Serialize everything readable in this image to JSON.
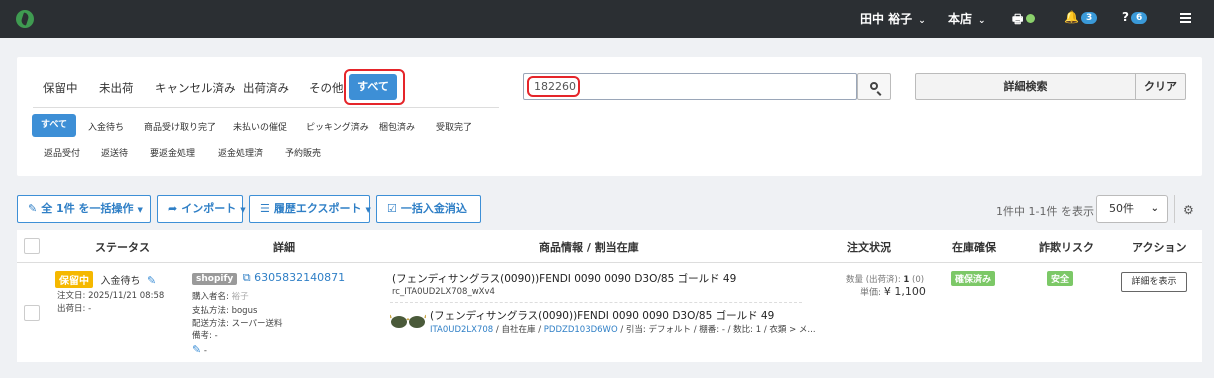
{
  "topbar": {
    "user": "田中 裕子",
    "store": "本店",
    "notifications_count": "3",
    "help_count": "6"
  },
  "status_tabs": [
    "保留中",
    "未出荷",
    "キャンセル済み",
    "出荷済み",
    "その他"
  ],
  "status_tab_active": "すべて",
  "sub_tabs_active": "すべて",
  "sub_tabs_row1": [
    "入金待ち",
    "商品受け取り完了",
    "未払いの催促",
    "ピッキング済み",
    "梱包済み",
    "受取完了"
  ],
  "sub_tabs_row2": [
    "返品受付",
    "返送待",
    "要返金処理",
    "返金処理済",
    "予約販売"
  ],
  "search": {
    "value": "182260",
    "detail_label": "詳細検索",
    "clear_label": "クリア"
  },
  "toolbar": {
    "bulk_label": "全 1件 を一括操作",
    "import_label": "インポート",
    "export_label": "履歴エクスポート",
    "payment_label": "一括入金消込",
    "page_info": "1件中 1-1件 を表示",
    "per_page": "50件"
  },
  "table": {
    "headers": [
      "ステータス",
      "詳細",
      "商品情報 / 割当在庫",
      "注文状況",
      "在庫確保",
      "詐欺リスク",
      "アクション"
    ],
    "rows": [
      {
        "status_badge": "保留中",
        "status_text": "入金待ち",
        "order_date_label": "注文日:",
        "order_date": "2025/11/21 08:58",
        "ship_date_label": "出荷日:",
        "ship_date": "-",
        "source_badge": "shopify",
        "order_id": "6305832140871",
        "buyer_label": "購入者名:",
        "buyer_name": "裕子",
        "payment_label": "支払方法:",
        "payment_method": "bogus",
        "delivery_label": "配送方法:",
        "delivery_method": "スーパー送料",
        "note_label": "備考:",
        "note_value": "-",
        "edit_value": "-",
        "product_name": "(フェンディサングラス(0090))FENDI 0090 0090 D3O/85 ゴールド 49",
        "product_code": "rc_ITA0UD2LX708_wXv4",
        "stock_name": "(フェンディサングラス(0090))FENDI 0090 0090 D3O/85 ゴールド 49",
        "stock_sku": "ITA0UD2LX708",
        "stock_location": "自社在庫",
        "stock_code": "PDDZD103D6WO",
        "stock_meta": "/ 引当: デフォルト / 棚番: - / 数比: 1 / 衣類 > メ...",
        "qty_label": "数量 (出荷済):",
        "qty_value": "1",
        "qty_shipped": "(0)",
        "price_label": "単価:",
        "price_value": "¥ 1,100",
        "stock_status": "確保済み",
        "fraud_risk": "安全",
        "action_label": "詳細を表示"
      }
    ]
  },
  "colors": {
    "topbar": "#2b2f33",
    "accent": "#3d8fd6",
    "highlight": "#e5252a",
    "badge_yellow": "#f5b800",
    "badge_green": "#7cc867"
  }
}
